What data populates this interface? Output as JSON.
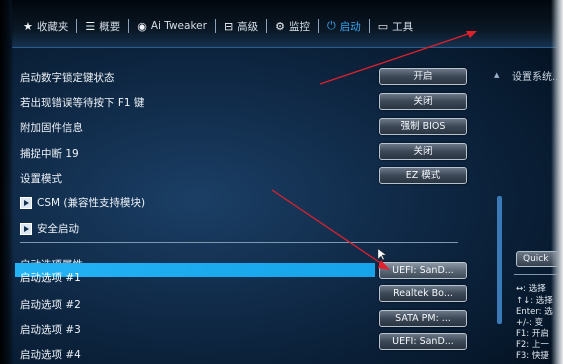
{
  "nav": {
    "tabs": [
      {
        "icon": "star-icon",
        "glyph": "★",
        "label": "收藏夹"
      },
      {
        "icon": "list-icon",
        "glyph": "☰",
        "label": "概要"
      },
      {
        "icon": "ai-tweaker-icon",
        "glyph": "◉",
        "label": "Ai Tweaker"
      },
      {
        "icon": "advanced-icon",
        "glyph": "⊟",
        "label": "高级"
      },
      {
        "icon": "monitor-icon",
        "glyph": "⚙",
        "label": "监控"
      },
      {
        "icon": "power-icon",
        "glyph": "⏻",
        "label": "启动"
      },
      {
        "icon": "tool-icon",
        "glyph": "▭",
        "label": "工具"
      }
    ],
    "active_index": 5,
    "active_color": "#39a6f2"
  },
  "settings": [
    {
      "label": "启动数字锁定键状态",
      "value": "开启"
    },
    {
      "label": "若出现错误等待按下 F1 键",
      "value": "关闭"
    },
    {
      "label": "附加固件信息",
      "value": "强制 BIOS"
    },
    {
      "label": "捕捉中断 19",
      "value": "关闭"
    },
    {
      "label": "设置模式",
      "value": "EZ 模式"
    }
  ],
  "submenus": [
    {
      "label": "CSM (兼容性支持模块)"
    },
    {
      "label": "安全启动"
    }
  ],
  "boot": {
    "section_title": "启动选项属性",
    "options": [
      {
        "label": "启动选项 #1",
        "value": "UEFI: SanD..."
      },
      {
        "label": "启动选项 #2",
        "value": "Realtek Bo..."
      },
      {
        "label": "启动选项 #3",
        "value": "SATA  PM: ..."
      },
      {
        "label": "启动选项 #4",
        "value": "UEFI: SanD..."
      }
    ],
    "highlight_color": "#1ea9ef"
  },
  "help": {
    "title": "设置系统...",
    "button": "Quick",
    "lines": [
      "↔: 选择",
      "↑↓: 选择",
      "Enter: 选",
      "+/-: 变",
      "F1: 开启",
      "F2: 上一",
      "F3: 快捷"
    ]
  },
  "annotation_color": "#e0202c"
}
